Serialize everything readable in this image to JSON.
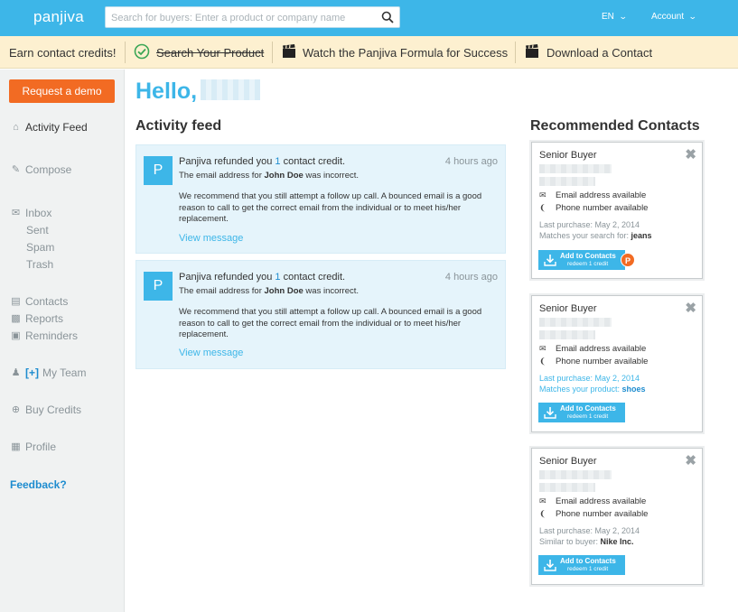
{
  "header": {
    "logo": "panjiva",
    "search_placeholder": "Search for buyers: Enter a product or company name",
    "language": "EN",
    "account": "Account"
  },
  "credits_bar": {
    "earn": "Earn contact credits!",
    "items": [
      {
        "label": "Search Your Product",
        "icon": "check-circle-icon",
        "done": true
      },
      {
        "label": "Watch the Panjiva Formula for Success",
        "icon": "clapperboard-icon"
      },
      {
        "label": "Download a Contact",
        "icon": "clapperboard-icon"
      }
    ]
  },
  "sidebar": {
    "demo_button": "Request a demo",
    "nav": [
      {
        "label": "Activity Feed",
        "icon": "home-icon"
      },
      {
        "label": "Compose",
        "icon": "pencil-icon"
      },
      {
        "label": "Inbox",
        "icon": "mail-icon"
      },
      {
        "label": "Contacts",
        "icon": "contacts-icon"
      },
      {
        "label": "Reports",
        "icon": "bar-chart-icon"
      },
      {
        "label": "Reminders",
        "icon": "calendar-icon"
      },
      {
        "label": "My Team",
        "icon": "team-icon",
        "prefix": "[+]"
      },
      {
        "label": "Buy Credits",
        "icon": "plus-circle-icon"
      },
      {
        "label": "Profile",
        "icon": "profile-icon"
      }
    ],
    "inbox_sub": [
      "Sent",
      "Spam",
      "Trash"
    ],
    "feedback": "Feedback?"
  },
  "main": {
    "hello": "Hello,",
    "activity_title": "Activity feed",
    "feed": [
      {
        "avatar": "P",
        "title_pre": "Panjiva refunded you ",
        "title_num": "1",
        "title_post": " contact credit.",
        "time": "4 hours ago",
        "line2_pre": "The email address for ",
        "line2_name": "John Doe",
        "line2_post": " was incorrect.",
        "body": "We recommend that you still attempt a follow up call. A bounced email is a good reason to call to get the correct email from the individual or to meet his/her replacement.",
        "link": "View message"
      },
      {
        "avatar": "P",
        "title_pre": "Panjiva refunded you ",
        "title_num": "1",
        "title_post": " contact credit.",
        "time": "4 hours ago",
        "line2_pre": "The email address for ",
        "line2_name": "John Doe",
        "line2_post": " was incorrect.",
        "body": "We recommend that you still attempt a follow up call. A bounced email is a good reason to call to get the correct email from the individual or to meet his/her replacement.",
        "link": "View message"
      }
    ]
  },
  "recommended": {
    "title": "Recommended Contacts",
    "contacts": [
      {
        "title": "Senior Buyer",
        "email": "Email address available",
        "phone": "Phone number available",
        "last_purchase": "Last purchase: May 2, 2014",
        "match_label": "Matches your search for: ",
        "match_value": "jeans",
        "btn_main": "Add to Contacts",
        "btn_sub": "redeem 1 credit",
        "badge": "P",
        "highlight": false
      },
      {
        "title": "Senior Buyer",
        "email": "Email address available",
        "phone": "Phone number available",
        "last_purchase": "Last purchase: May 2, 2014",
        "match_label": "Matches your product: ",
        "match_value": "shoes",
        "btn_main": "Add to Contacts",
        "btn_sub": "redeem 1 credit",
        "highlight": true
      },
      {
        "title": "Senior Buyer",
        "email": "Email address available",
        "phone": "Phone number available",
        "last_purchase": "Last purchase: May 2, 2014",
        "match_label": "Similar to buyer: ",
        "match_value": "Nike Inc.",
        "btn_main": "Add to Contacts",
        "btn_sub": "redeem 1 credit",
        "highlight": false
      }
    ]
  },
  "colors": {
    "brand": "#3db6e8",
    "accent": "#f26b23",
    "credits_bg": "#fdf0d0",
    "feed_bg": "#e5f4fb"
  }
}
